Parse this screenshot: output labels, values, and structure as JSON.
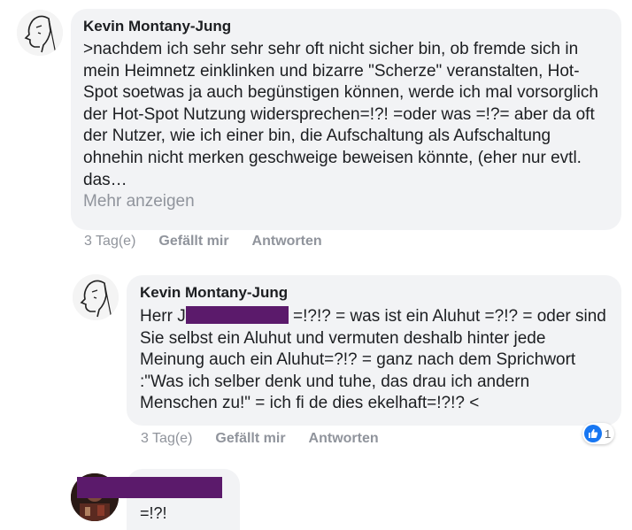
{
  "comments": [
    {
      "author": "Kevin Montany-Jung",
      "text": ">nachdem ich sehr sehr sehr oft nicht sicher bin, ob fremde sich in mein Heimnetz einklinken und bizarre \"Scherze\" veranstalten, Hot-Spot soetwas ja auch begünstigen können, werde ich mal vorsorglich der Hot-Spot Nutzung widersprechen=!?! =oder was =!?= aber da oft der Nutzer, wie ich einer bin, die Aufschaltung als Aufschaltung ohnehin nicht merken geschweige beweisen könnte, (eher nur evtl. das…",
      "more_label": "Mehr anzeigen",
      "time": "3 Tag(e)",
      "like_label": "Gefällt mir",
      "reply_label": "Antworten"
    },
    {
      "author": "Kevin Montany-Jung",
      "text_prefix": "Herr J",
      "text_after": " =!?!? = was ist ein Aluhut =?!? = oder sind Sie selbst ein Aluhut und vermuten deshalb hinter jede Meinung auch ein Aluhut=?!? = ganz nach dem Sprichwort :\"Was ich selber denk und tuhe, das drau ich andern Menschen zu!\" = ich fi de dies ekelhaft=!?!? <",
      "time": "3 Tag(e)",
      "like_label": "Gefällt mir",
      "reply_label": "Antworten",
      "reaction_count": "1",
      "reaction_icon": "like-icon"
    },
    {
      "text": "=!?!"
    }
  ],
  "colors": {
    "bubble": "#f2f3f5",
    "meta": "#90949c",
    "redaction": "#5b1a6b",
    "like": "#1877f2"
  }
}
